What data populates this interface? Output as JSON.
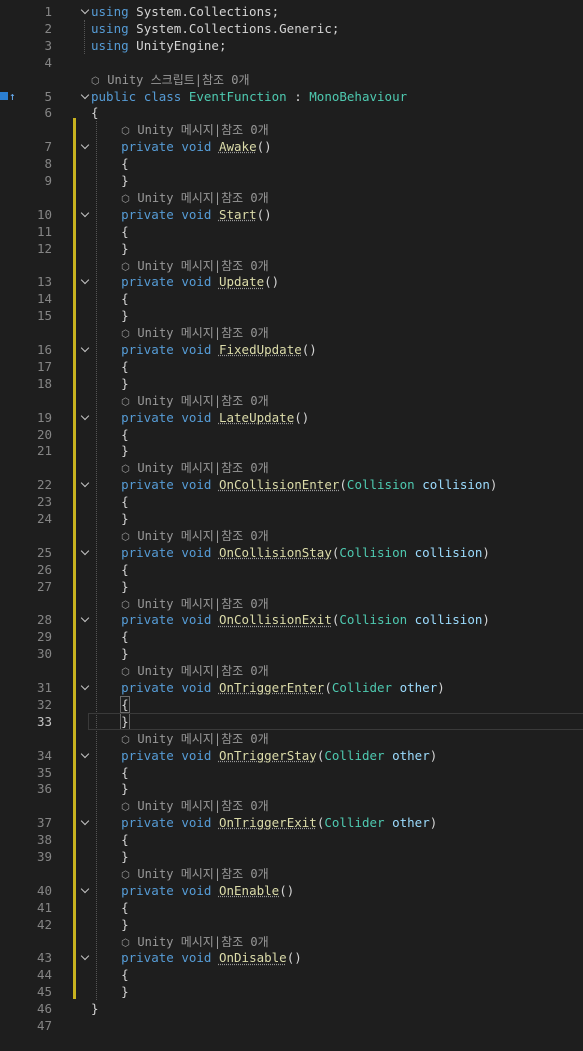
{
  "editor": {
    "line_numbers": [
      "1",
      "2",
      "3",
      "4",
      "5",
      "6",
      "7",
      "8",
      "9",
      "10",
      "11",
      "12",
      "13",
      "14",
      "15",
      "16",
      "17",
      "18",
      "19",
      "20",
      "21",
      "22",
      "23",
      "24",
      "25",
      "26",
      "27",
      "28",
      "29",
      "30",
      "31",
      "32",
      "33",
      "34",
      "35",
      "36",
      "37",
      "38",
      "39",
      "40",
      "41",
      "42",
      "43",
      "44",
      "45",
      "46",
      "47"
    ],
    "current_line": "33",
    "codelens": {
      "class_text": "Unity 스크립트|참조 0개",
      "method_text": "Unity 메시지|참조 0개"
    },
    "keywords": {
      "using": "using",
      "public": "public",
      "class": "class",
      "private": "private",
      "void": "void"
    },
    "usings": [
      "System.Collections",
      "System.Collections.Generic",
      "UnityEngine"
    ],
    "class_name": "EventFunction",
    "base_class": "MonoBehaviour",
    "methods": [
      {
        "name": "Awake",
        "param_type": "",
        "param_name": ""
      },
      {
        "name": "Start",
        "param_type": "",
        "param_name": ""
      },
      {
        "name": "Update",
        "param_type": "",
        "param_name": ""
      },
      {
        "name": "FixedUpdate",
        "param_type": "",
        "param_name": ""
      },
      {
        "name": "LateUpdate",
        "param_type": "",
        "param_name": ""
      },
      {
        "name": "OnCollisionEnter",
        "param_type": "Collision",
        "param_name": "collision"
      },
      {
        "name": "OnCollisionStay",
        "param_type": "Collision",
        "param_name": "collision"
      },
      {
        "name": "OnCollisionExit",
        "param_type": "Collision",
        "param_name": "collision"
      },
      {
        "name": "OnTriggerEnter",
        "param_type": "Collider",
        "param_name": "other"
      },
      {
        "name": "OnTriggerStay",
        "param_type": "Collider",
        "param_name": "other"
      },
      {
        "name": "OnTriggerExit",
        "param_type": "Collider",
        "param_name": "other"
      },
      {
        "name": "OnEnable",
        "param_type": "",
        "param_name": ""
      },
      {
        "name": "OnDisable",
        "param_type": "",
        "param_name": ""
      }
    ]
  },
  "colors": {
    "background": "#1e1e1e",
    "keyword": "#569cd6",
    "type": "#4ec9b0",
    "method": "#dcdcaa",
    "parameter": "#9cdcfe",
    "line_number": "#858585",
    "change_marker": "#c8b21f"
  },
  "icons": {
    "codelens_icon": "unity-cube-icon",
    "fold_icon": "chevron-down-icon",
    "gutter_icon": "bookmark-icon"
  }
}
